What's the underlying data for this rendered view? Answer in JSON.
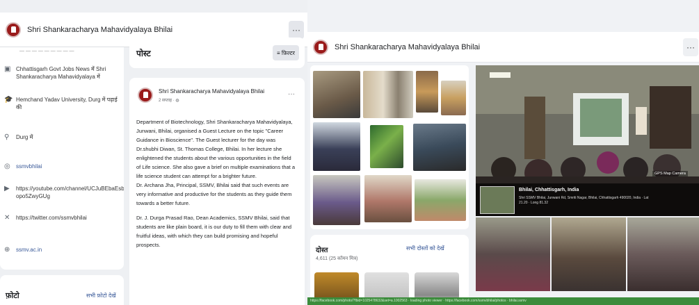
{
  "left_pane": {
    "page_name": "Shri Shankaracharya Mahavidyalaya Bhilai",
    "more_glyph": "···",
    "about_items": [
      {
        "icon": "work-icon",
        "text": "Chhattisgarh Govt Jobs News में Shri Shankaracharya Mahavidyalaya में",
        "link": false
      },
      {
        "icon": "school-icon",
        "text": "Hemchand Yadav University, Durg में पढ़ाई की",
        "link": false
      },
      {
        "icon": "location-icon",
        "text": "Durg में",
        "link": false
      },
      {
        "icon": "instagram-icon",
        "text": "ssmvbhilai",
        "link": true
      },
      {
        "icon": "youtube-icon",
        "text": "https://youtube.com/channel/UCJuBEbaEsb opo5ZwyGUg",
        "link": false
      },
      {
        "icon": "x-icon",
        "text": "https://twitter.com/ssmvbhilai",
        "link": false
      },
      {
        "icon": "globe-icon",
        "text": "ssmv.ac.in",
        "link": true
      }
    ],
    "photos_title": "फ़ोटो",
    "photos_link": "सभी फ़ोटो देखें",
    "posts_title": "पोस्ट",
    "filter_label": "≡ फ़िल्टर",
    "post": {
      "author": "Shri Shankaracharya Mahavidyalaya Bhilai",
      "time": "2 सप्ताह · ◍",
      "dots": "···",
      "paragraphs": [
        "Department of Biotechnology, Shri Shankaracharya Mahavidyalaya, Junwani, Bhilai, organised a Guest Lecture on the topic \"Career Guidance in Bioscience\". The Guest lecturer for the day was Dr.shubhi Diwan, St. Thomas College, Bhilai. In her lecture she enlightened the students about the various opportunities in the field of Life science. She also gave a brief on multiple examinations that a life science student can attempt for a brighter future.",
        "Dr. Archana Jha, Principal, SSMV, Bhilai said that such events are very informative and productive for the students as they guide them towards a better future.",
        "Dr. J. Durga Prasad Rao, Dean Academics, SSMV Bhilai, said that students are like plain board, it is our duty to fill them with clear and fruitful ideas, with which they can build promising and hopeful prospects."
      ]
    }
  },
  "right_pane": {
    "page_name": "Shri Shankaracharya Mahavidyalaya Bhilai",
    "more_glyph": "···",
    "friends_title": "दोस्त",
    "friends_count": "4,611 (25 कॉमन मित्र)",
    "friends_link": "सभी दोस्तों को देखें",
    "gps": {
      "location": "Bhilai, Chhattisgarh, India",
      "address": "Shri SSMV Bhilai, Junwani Rd, Smriti Nagar, Bhilai, Chhattisgarh 490020, India · Lat 21.20 · Long 81.32",
      "camera_label": "GPS Map Camera"
    },
    "status_text": "https://facebook.com/photo/?fbid=1025478632&set=a.1002563 · loading photo viewer · https://facebook.com/ssmvbhilai/photos · bhilai.ssmv"
  },
  "colors": {
    "brand": "#9a1b1b",
    "link": "#385898",
    "background": "#f0f2f5",
    "status_green": "#3c8c3c"
  }
}
